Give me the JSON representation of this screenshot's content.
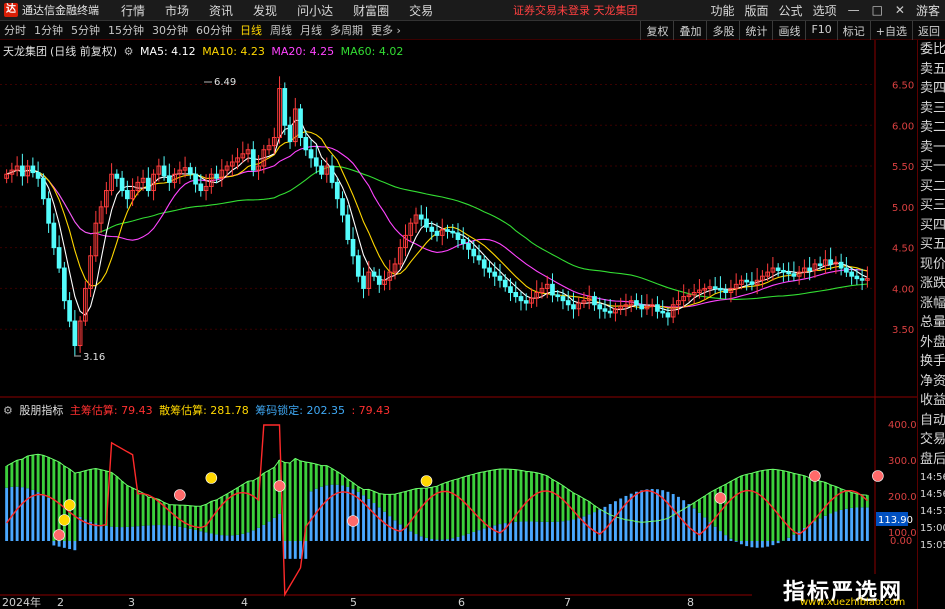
{
  "app": {
    "logo": "达",
    "title": "通达信金融终端",
    "notice": "证券交易未登录  天龙集团"
  },
  "menu": [
    "行情",
    "市场",
    "资讯",
    "发现",
    "问小达",
    "财富圈",
    "交易"
  ],
  "right_menu": [
    "功能",
    "版面",
    "公式",
    "选项"
  ],
  "window_controls": [
    "—",
    "□",
    "✕"
  ],
  "guest": "游客",
  "toolbar": {
    "timeframes": [
      {
        "label": "分时",
        "active": false
      },
      {
        "label": "1分钟",
        "active": false
      },
      {
        "label": "5分钟",
        "active": false
      },
      {
        "label": "15分钟",
        "active": false
      },
      {
        "label": "30分钟",
        "active": false
      },
      {
        "label": "60分钟",
        "active": false
      },
      {
        "label": "日线",
        "active": true
      },
      {
        "label": "周线",
        "active": false
      },
      {
        "label": "月线",
        "active": false
      },
      {
        "label": "多周期",
        "active": false
      },
      {
        "label": "更多 ›",
        "active": false
      }
    ],
    "tools": [
      "复权",
      "叠加",
      "多股",
      "统计",
      "画线",
      "F10",
      "标记",
      "+自选",
      "返回"
    ]
  },
  "main_info": {
    "stock": "天龙集团",
    "period_note": "(日线 前复权)",
    "ma": [
      {
        "label": "MA5: 4.12",
        "color": "#ffffff"
      },
      {
        "label": "MA10: 4.23",
        "color": "#ffd700"
      },
      {
        "label": "MA20: 4.25",
        "color": "#ff44ff"
      },
      {
        "label": "MA60: 4.02",
        "color": "#33dd33"
      }
    ]
  },
  "sub_info": {
    "name": "股朋指标",
    "items": [
      {
        "label": "主筹估算: 79.43",
        "color": "#ff3030"
      },
      {
        "label": "散筹估算: 281.78",
        "color": "#ffd700"
      },
      {
        "label": "筹码锁定: 202.35",
        "color": "#3fa9f5"
      },
      {
        "label": ": 79.43",
        "color": "#ff3030"
      }
    ]
  },
  "price_axis": [
    "6.50",
    "6.00",
    "5.50",
    "5.00",
    "4.50",
    "4.00",
    "3.50"
  ],
  "sub_axis": [
    "400.0",
    "300.0",
    "200.0",
    "100.0",
    "0.00"
  ],
  "sub_current": "113.90",
  "price_marks": {
    "high": "6.49",
    "low": "3.16"
  },
  "date_axis": [
    "2024年",
    "2",
    "3",
    "4",
    "5",
    "6",
    "7",
    "8"
  ],
  "side_panel": [
    "委比",
    "卖五",
    "卖四",
    "卖三",
    "卖二",
    "卖一",
    "买一",
    "买二",
    "买三",
    "买四",
    "买五",
    "现价",
    "涨跌",
    "涨幅",
    "总量",
    "外盘",
    "换手",
    "净资",
    "收益",
    "自动",
    "交易",
    "盘后",
    "14:56",
    "14:56",
    "14:57",
    "15:00",
    "15:05"
  ],
  "watermark": {
    "line1": "指标严选网",
    "line2": "www.xuezhibiao.com"
  },
  "chart_data": {
    "type": "candlestick",
    "ylim": [
      3.0,
      6.8
    ],
    "close": [
      5.4,
      5.45,
      5.5,
      5.38,
      5.5,
      5.42,
      5.35,
      5.1,
      4.8,
      4.5,
      4.25,
      3.85,
      3.6,
      3.3,
      3.6,
      4.0,
      4.4,
      4.8,
      5.0,
      5.2,
      5.4,
      5.35,
      5.2,
      5.1,
      5.2,
      5.3,
      5.35,
      5.2,
      5.4,
      5.5,
      5.38,
      5.3,
      5.4,
      5.45,
      5.48,
      5.4,
      5.28,
      5.2,
      5.25,
      5.4,
      5.35,
      5.45,
      5.5,
      5.55,
      5.6,
      5.65,
      5.7,
      5.45,
      5.5,
      5.7,
      5.75,
      5.85,
      6.45,
      6.0,
      5.8,
      6.2,
      5.85,
      5.7,
      5.6,
      5.5,
      5.4,
      5.5,
      5.3,
      5.1,
      4.9,
      4.6,
      4.4,
      4.15,
      4.0,
      4.2,
      4.15,
      4.05,
      4.1,
      4.2,
      4.3,
      4.5,
      4.65,
      4.8,
      4.9,
      4.85,
      4.75,
      4.7,
      4.65,
      4.72,
      4.7,
      4.68,
      4.6,
      4.55,
      4.48,
      4.4,
      4.35,
      4.25,
      4.2,
      4.15,
      4.1,
      4.02,
      3.95,
      3.9,
      3.85,
      3.82,
      3.88,
      3.95,
      4.0,
      4.05,
      3.92,
      3.9,
      3.85,
      3.8,
      3.75,
      3.82,
      3.85,
      3.9,
      3.8,
      3.75,
      3.72,
      3.7,
      3.75,
      3.78,
      3.8,
      3.85,
      3.8,
      3.75,
      3.78,
      3.8,
      3.72,
      3.7,
      3.65,
      3.8,
      3.85,
      3.9,
      3.92,
      3.95,
      3.98,
      4.0,
      4.02,
      4.0,
      3.98,
      3.95,
      4.0,
      4.05,
      4.1,
      4.08,
      4.05,
      4.1,
      4.15,
      4.2,
      4.25,
      4.22,
      4.2,
      4.18,
      4.15,
      4.2,
      4.25,
      4.22,
      4.3,
      4.28,
      4.35,
      4.3,
      4.32,
      4.25,
      4.2,
      4.15,
      4.12,
      4.1,
      4.12
    ]
  }
}
